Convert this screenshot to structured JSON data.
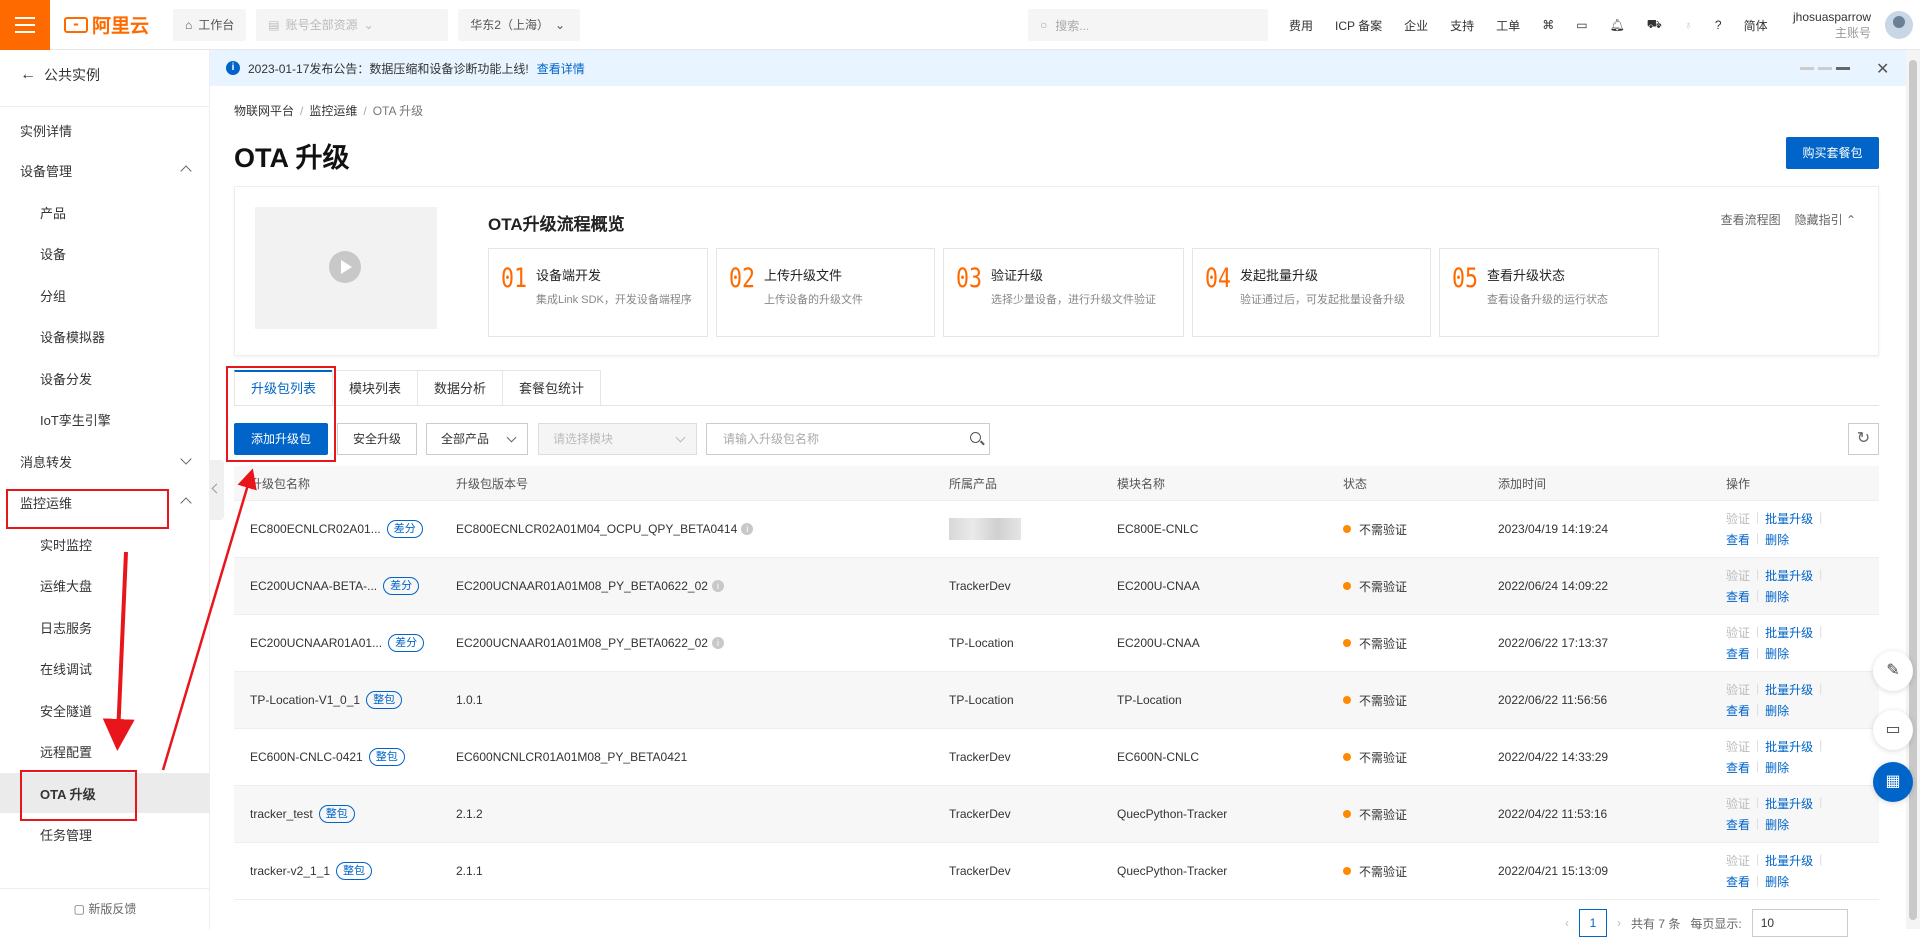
{
  "topbar": {
    "workbench": "工作台",
    "account_scope": "账号全部资源",
    "region": "华东2（上海）",
    "search_placeholder": "搜索...",
    "nav": [
      "费用",
      "ICP 备案",
      "企业",
      "支持",
      "工单"
    ],
    "lang": "简体",
    "username": "jhosuasparrow",
    "account_type": "主账号"
  },
  "notice": {
    "text": "2023-01-17发布公告：数据压缩和设备诊断功能上线!",
    "link": "查看详情"
  },
  "sidebar": {
    "back_label": "公共实例",
    "items": [
      {
        "label": "实例详情"
      },
      {
        "label": "设备管理"
      },
      {
        "label": "产品"
      },
      {
        "label": "设备"
      },
      {
        "label": "分组"
      },
      {
        "label": "设备模拟器"
      },
      {
        "label": "设备分发"
      },
      {
        "label": "IoT孪生引擎"
      },
      {
        "label": "消息转发"
      },
      {
        "label": "监控运维"
      },
      {
        "label": "实时监控"
      },
      {
        "label": "运维大盘"
      },
      {
        "label": "日志服务"
      },
      {
        "label": "在线调试"
      },
      {
        "label": "安全隧道"
      },
      {
        "label": "远程配置"
      },
      {
        "label": "OTA 升级"
      },
      {
        "label": "任务管理"
      }
    ],
    "feedback": "新版反馈"
  },
  "breadcrumb": [
    "物联网平台",
    "监控运维",
    "OTA 升级"
  ],
  "page_title": "OTA 升级",
  "buy_button": "购买套餐包",
  "overview": {
    "title": "OTA升级流程概览",
    "link_flow": "查看流程图",
    "link_hide": "隐藏指引",
    "steps": [
      {
        "num": "01",
        "title": "设备端开发",
        "desc": "集成Link SDK，开发设备端程序"
      },
      {
        "num": "02",
        "title": "上传升级文件",
        "desc": "上传设备的升级文件"
      },
      {
        "num": "03",
        "title": "验证升级",
        "desc": "选择少量设备，进行升级文件验证"
      },
      {
        "num": "04",
        "title": "发起批量升级",
        "desc": "验证通过后，可发起批量设备升级"
      },
      {
        "num": "05",
        "title": "查看升级状态",
        "desc": "查看设备升级的运行状态"
      }
    ]
  },
  "tabs": [
    "升级包列表",
    "模块列表",
    "数据分析",
    "套餐包统计"
  ],
  "toolbar": {
    "add_button": "添加升级包",
    "secure_button": "安全升级",
    "product_select": "全部产品",
    "module_placeholder": "请选择模块",
    "search_placeholder": "请输入升级包名称"
  },
  "table": {
    "headers": [
      "升级包名称",
      "升级包版本号",
      "所属产品",
      "模块名称",
      "状态",
      "添加时间",
      "操作"
    ],
    "rows": [
      {
        "name": "EC800ECNLCR02A01...",
        "tag": "差分",
        "version": "EC800ECNLCR02A01M04_OCPU_QPY_BETA0414",
        "product": "",
        "module": "EC800E-CNLC",
        "status": "不需验证",
        "time": "2023/04/19 14:19:24"
      },
      {
        "name": "EC200UCNAA-BETA-...",
        "tag": "差分",
        "version": "EC200UCNAAR01A01M08_PY_BETA0622_02",
        "product": "TrackerDev",
        "module": "EC200U-CNAA",
        "status": "不需验证",
        "time": "2022/06/24 14:09:22"
      },
      {
        "name": "EC200UCNAAR01A01...",
        "tag": "差分",
        "version": "EC200UCNAAR01A01M08_PY_BETA0622_02",
        "product": "TP-Location",
        "module": "EC200U-CNAA",
        "status": "不需验证",
        "time": "2022/06/22 17:13:37"
      },
      {
        "name": "TP-Location-V1_0_1",
        "tag": "整包",
        "version": "1.0.1",
        "product": "TP-Location",
        "module": "TP-Location",
        "status": "不需验证",
        "time": "2022/06/22 11:56:56"
      },
      {
        "name": "EC600N-CNLC-0421",
        "tag": "整包",
        "version": "EC600NCNLCR01A01M08_PY_BETA0421",
        "product": "TrackerDev",
        "module": "EC600N-CNLC",
        "status": "不需验证",
        "time": "2022/04/22 14:33:29"
      },
      {
        "name": "tracker_test",
        "tag": "整包",
        "version": "2.1.2",
        "product": "TrackerDev",
        "module": "QuecPython-Tracker",
        "status": "不需验证",
        "time": "2022/04/22 11:53:16"
      },
      {
        "name": "tracker-v2_1_1",
        "tag": "整包",
        "version": "2.1.1",
        "product": "TrackerDev",
        "module": "QuecPython-Tracker",
        "status": "不需验证",
        "time": "2022/04/21 15:13:09"
      }
    ],
    "ops": {
      "verify": "验证",
      "batch": "批量升级",
      "view": "查看",
      "delete": "删除"
    }
  },
  "pager": {
    "page": "1",
    "total": "共有 7 条",
    "per_page_label": "每页显示:",
    "per_page": "10"
  },
  "colors": {
    "brand": "#ff6a00",
    "primary": "#0064c8",
    "status_dot": "#ff8a00",
    "annotation": "#e8161b"
  }
}
